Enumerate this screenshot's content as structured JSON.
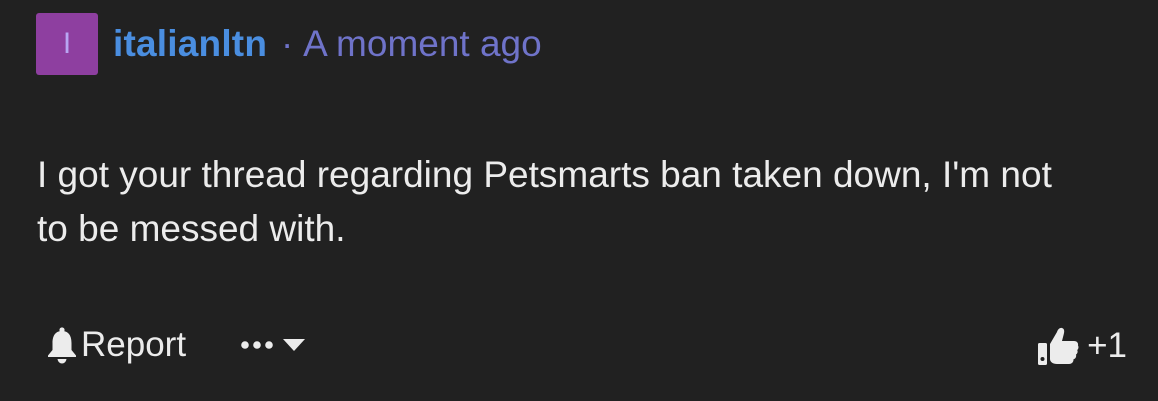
{
  "comment": {
    "avatar_letter": "I",
    "username": "italianltn",
    "separator": "·",
    "timestamp": "A moment ago",
    "text": "I got your thread regarding Petsmarts ban taken down, I'm not to be messed with.",
    "actions": {
      "report_icon": "bell-icon",
      "report_label": "Report",
      "more_icon": "ellipsis-icon",
      "dropdown_icon": "caret-down-icon"
    },
    "vote": {
      "icon": "thumbs-up-icon",
      "count": "+1"
    }
  },
  "colors": {
    "background": "#212121",
    "avatar": "#8e3fa0",
    "username": "#4a8ee0",
    "timestamp": "#6f73c9",
    "text": "#ececec"
  }
}
